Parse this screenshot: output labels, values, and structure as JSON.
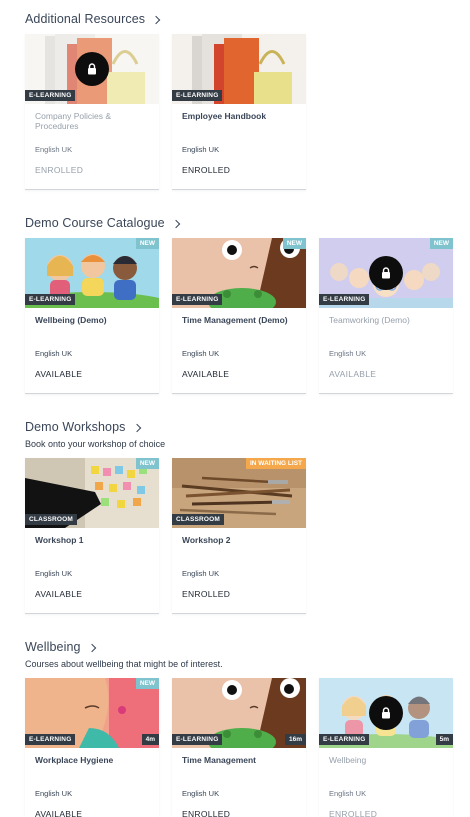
{
  "sections": [
    {
      "title": "Additional Resources",
      "subtitle": "",
      "cards": [
        {
          "title": "Company Policies & Procedures",
          "type": "E-LEARNING",
          "lang": "English UK",
          "status": "ENROLLED",
          "badge": "",
          "duration": "",
          "locked": true
        },
        {
          "title": "Employee Handbook",
          "type": "E-LEARNING",
          "lang": "English UK",
          "status": "ENROLLED",
          "badge": "",
          "duration": "",
          "locked": false
        }
      ]
    },
    {
      "title": "Demo Course Catalogue",
      "subtitle": "",
      "cards": [
        {
          "title": "Wellbeing (Demo)",
          "type": "E-LEARNING",
          "lang": "English UK",
          "status": "AVAILABLE",
          "badge": "NEW",
          "duration": "",
          "locked": false
        },
        {
          "title": "Time Management (Demo)",
          "type": "E-LEARNING",
          "lang": "English UK",
          "status": "AVAILABLE",
          "badge": "NEW",
          "duration": "",
          "locked": false
        },
        {
          "title": "Teamworking (Demo)",
          "type": "E-LEARNING",
          "lang": "English UK",
          "status": "AVAILABLE",
          "badge": "NEW",
          "duration": "",
          "locked": true
        }
      ]
    },
    {
      "title": "Demo Workshops",
      "subtitle": "Book onto your workshop of choice",
      "cards": [
        {
          "title": "Workshop 1",
          "type": "CLASSROOM",
          "lang": "English UK",
          "status": "AVAILABLE",
          "badge": "NEW",
          "duration": "",
          "locked": false
        },
        {
          "title": "Workshop 2",
          "type": "CLASSROOM",
          "lang": "English UK",
          "status": "ENROLLED",
          "badge": "IN WAITING LIST",
          "duration": "",
          "locked": false
        }
      ]
    },
    {
      "title": "Wellbeing",
      "subtitle": "Courses about wellbeing that might be of interest.",
      "cards": [
        {
          "title": "Workplace Hygiene",
          "type": "E-LEARNING",
          "lang": "English UK",
          "status": "AVAILABLE",
          "badge": "NEW",
          "duration": "4m",
          "locked": false
        },
        {
          "title": "Time Management",
          "type": "E-LEARNING",
          "lang": "English UK",
          "status": "ENROLLED",
          "badge": "",
          "duration": "16m",
          "locked": false
        },
        {
          "title": "Wellbeing",
          "type": "E-LEARNING",
          "lang": "English UK",
          "status": "ENROLLED",
          "badge": "",
          "duration": "5m",
          "locked": true
        }
      ]
    }
  ],
  "colors": {
    "new_badge": "#7fc3cf",
    "waiting_badge": "#f4a74b",
    "type_tag": "#333b44"
  },
  "icons": {
    "lock": "lock-icon",
    "chevron": "chevron-right-icon"
  }
}
